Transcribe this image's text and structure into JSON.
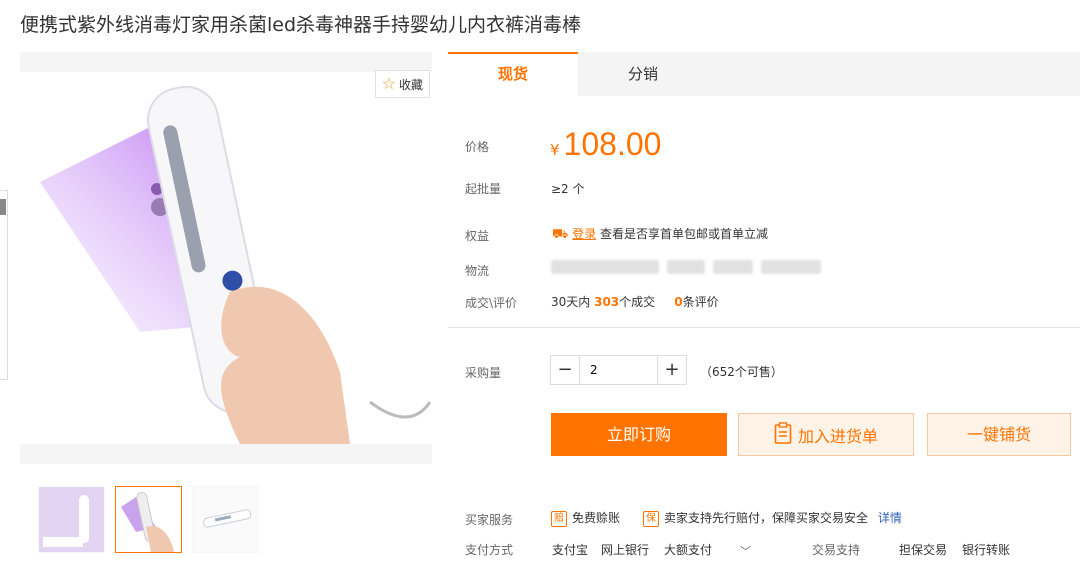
{
  "product": {
    "title": "便携式紫外线消毒灯家用杀菌led杀毒神器手持婴幼儿内衣裤消毒棒"
  },
  "gallery": {
    "favorite_label": "收藏",
    "thumb_count": 3
  },
  "tabs": [
    {
      "label": "现货",
      "active": true
    },
    {
      "label": "分销",
      "active": false
    }
  ],
  "price": {
    "label": "价格",
    "currency": "¥",
    "value": "108.00"
  },
  "moq": {
    "label": "起批量",
    "value": "≥2 个"
  },
  "benefit": {
    "label": "权益",
    "link": "登录",
    "text": "查看是否享首单包邮或首单立减"
  },
  "logistics": {
    "label": "物流"
  },
  "deals": {
    "label": "成交\\评价",
    "prefix": "30天内",
    "count": "303",
    "count_suffix": "个成交",
    "reviews": "0",
    "reviews_suffix": "条评价"
  },
  "quantity": {
    "label": "采购量",
    "value": "2",
    "available": "（652个可售）"
  },
  "actions": {
    "buy": "立即订购",
    "cart": "加入进货单",
    "distribute": "一键铺货"
  },
  "services": {
    "label": "买家服务",
    "item1_icon": "赔",
    "item1": "免费赊账",
    "item2_icon": "保",
    "item2": "卖家支持先行赔付，保障买家交易安全",
    "details": "详情"
  },
  "payment": {
    "label": "支付方式",
    "methods": [
      "支付宝",
      "网上银行",
      "大额支付"
    ],
    "trade_label": "交易支持",
    "trade_items": [
      "担保交易",
      "银行转账"
    ]
  },
  "colors": {
    "accent": "#ff7300",
    "link": "#3062b8"
  }
}
